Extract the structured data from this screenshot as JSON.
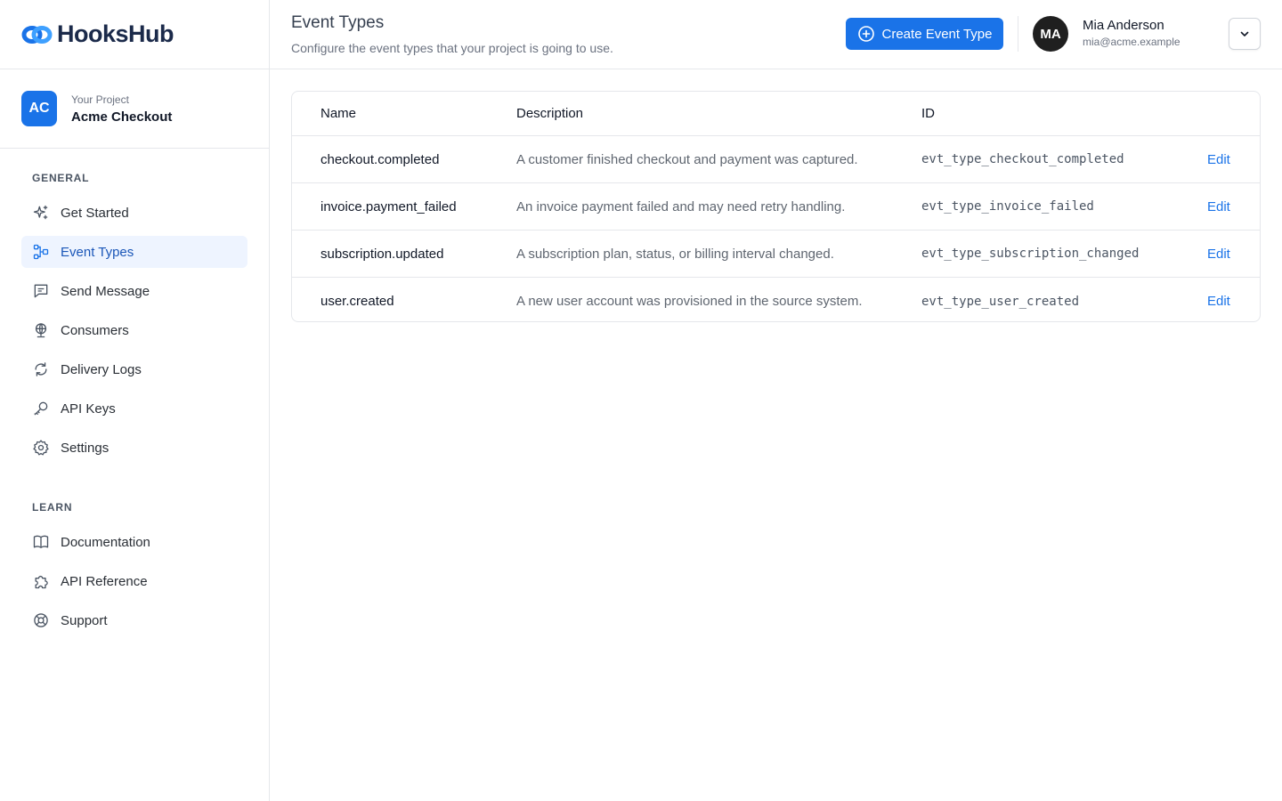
{
  "brand": {
    "name": "HooksHub",
    "accent": "#1a73e8"
  },
  "project": {
    "initials": "AC",
    "label": "Your Project",
    "name": "Acme Checkout"
  },
  "nav": {
    "general_label": "GENERAL",
    "general": [
      {
        "label": "Get Started",
        "icon": "sparkle-icon"
      },
      {
        "label": "Event Types",
        "icon": "event-types-icon",
        "active": true
      },
      {
        "label": "Send Message",
        "icon": "message-icon"
      },
      {
        "label": "Consumers",
        "icon": "globe-icon"
      },
      {
        "label": "Delivery Logs",
        "icon": "refresh-icon"
      },
      {
        "label": "API Keys",
        "icon": "key-icon"
      },
      {
        "label": "Settings",
        "icon": "gear-icon"
      }
    ],
    "learn_label": "LEARN",
    "learn": [
      {
        "label": "Documentation",
        "icon": "book-icon"
      },
      {
        "label": "API Reference",
        "icon": "puzzle-icon"
      },
      {
        "label": "Support",
        "icon": "lifebuoy-icon"
      }
    ]
  },
  "header": {
    "title": "Event Types",
    "subtitle": "Configure the event types that your project is going to use.",
    "create_label": "Create Event Type"
  },
  "user": {
    "initials": "MA",
    "name": "Mia Anderson",
    "email": "mia@acme.example"
  },
  "table": {
    "columns": [
      "Name",
      "Description",
      "ID"
    ],
    "rows": [
      {
        "name": "checkout.completed",
        "description": "A customer finished checkout and payment was captured.",
        "id": "evt_type_checkout_completed",
        "action": "Edit"
      },
      {
        "name": "invoice.payment_failed",
        "description": "An invoice payment failed and may need retry handling.",
        "id": "evt_type_invoice_failed",
        "action": "Edit"
      },
      {
        "name": "subscription.updated",
        "description": "A subscription plan, status, or billing interval changed.",
        "id": "evt_type_subscription_changed",
        "action": "Edit"
      },
      {
        "name": "user.created",
        "description": "A new user account was provisioned in the source system.",
        "id": "evt_type_user_created",
        "action": "Edit"
      }
    ]
  }
}
